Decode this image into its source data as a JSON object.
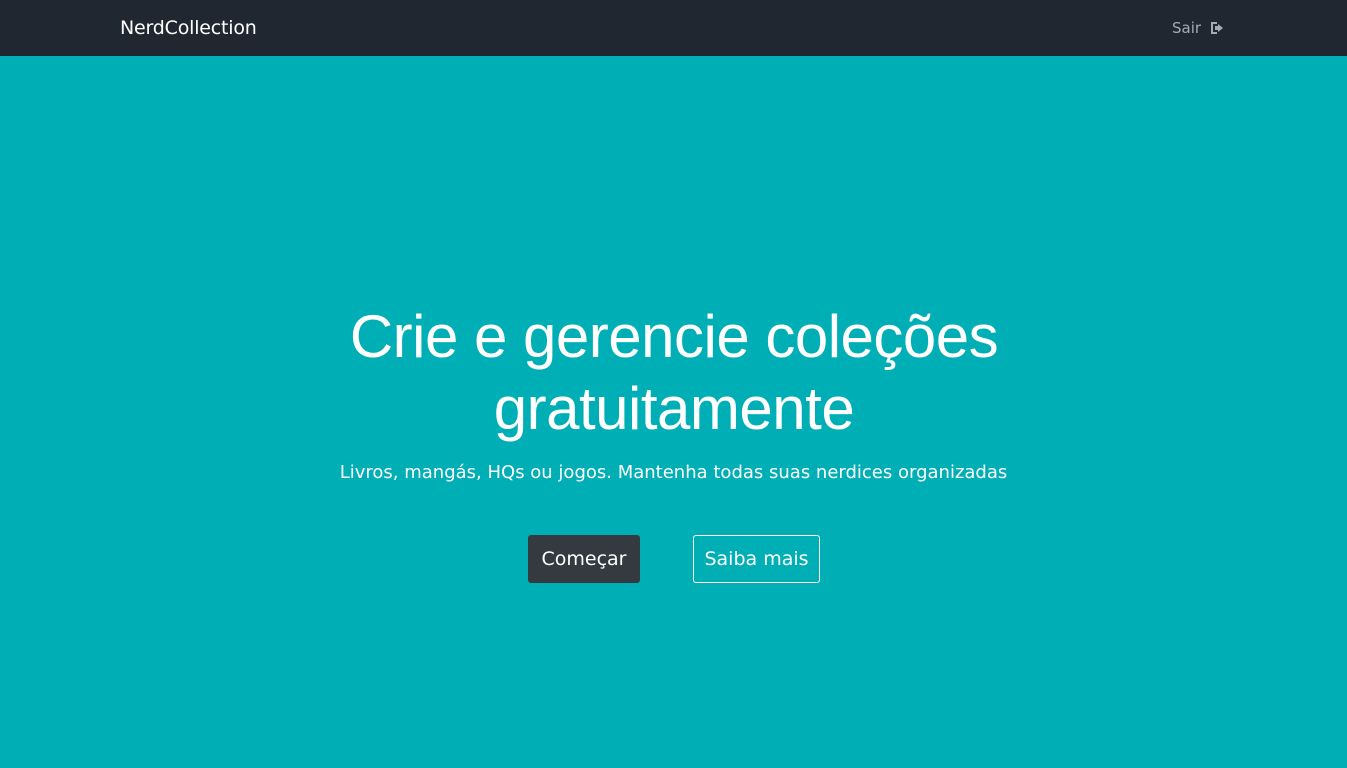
{
  "navbar": {
    "brand": "NerdCollection",
    "logout_label": "Sair",
    "logout_icon": "sign-out-icon"
  },
  "hero": {
    "title": "Crie e gerencie coleções gratuitamente",
    "subtitle": "Livros, mangás, HQs ou jogos. Mantenha todas suas nerdices organizadas",
    "start_button": "Começar",
    "learn_more_button": "Saiba mais"
  },
  "colors": {
    "navbar_bg": "#212731",
    "hero_bg": "#00afb6",
    "primary_button": "#343a40",
    "text": "#ffffff",
    "muted_link": "#a4aab2"
  }
}
